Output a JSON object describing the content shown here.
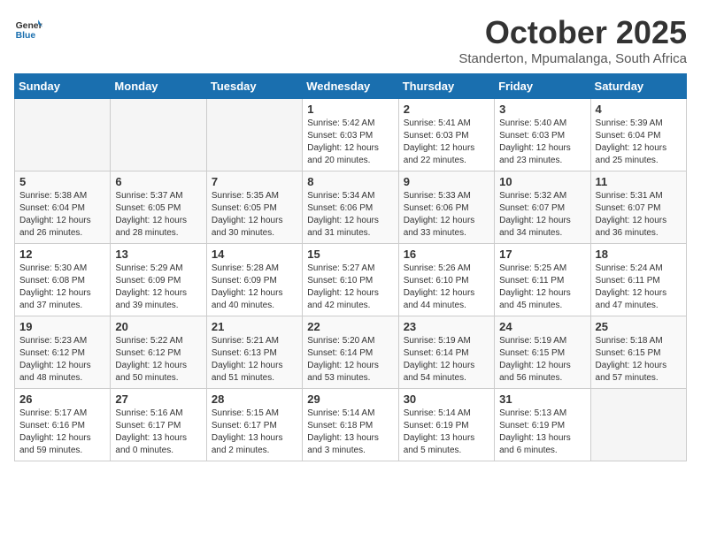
{
  "header": {
    "logo_general": "General",
    "logo_blue": "Blue",
    "month": "October 2025",
    "location": "Standerton, Mpumalanga, South Africa"
  },
  "weekdays": [
    "Sunday",
    "Monday",
    "Tuesday",
    "Wednesday",
    "Thursday",
    "Friday",
    "Saturday"
  ],
  "weeks": [
    [
      {
        "day": "",
        "info": ""
      },
      {
        "day": "",
        "info": ""
      },
      {
        "day": "",
        "info": ""
      },
      {
        "day": "1",
        "info": "Sunrise: 5:42 AM\nSunset: 6:03 PM\nDaylight: 12 hours\nand 20 minutes."
      },
      {
        "day": "2",
        "info": "Sunrise: 5:41 AM\nSunset: 6:03 PM\nDaylight: 12 hours\nand 22 minutes."
      },
      {
        "day": "3",
        "info": "Sunrise: 5:40 AM\nSunset: 6:03 PM\nDaylight: 12 hours\nand 23 minutes."
      },
      {
        "day": "4",
        "info": "Sunrise: 5:39 AM\nSunset: 6:04 PM\nDaylight: 12 hours\nand 25 minutes."
      }
    ],
    [
      {
        "day": "5",
        "info": "Sunrise: 5:38 AM\nSunset: 6:04 PM\nDaylight: 12 hours\nand 26 minutes."
      },
      {
        "day": "6",
        "info": "Sunrise: 5:37 AM\nSunset: 6:05 PM\nDaylight: 12 hours\nand 28 minutes."
      },
      {
        "day": "7",
        "info": "Sunrise: 5:35 AM\nSunset: 6:05 PM\nDaylight: 12 hours\nand 30 minutes."
      },
      {
        "day": "8",
        "info": "Sunrise: 5:34 AM\nSunset: 6:06 PM\nDaylight: 12 hours\nand 31 minutes."
      },
      {
        "day": "9",
        "info": "Sunrise: 5:33 AM\nSunset: 6:06 PM\nDaylight: 12 hours\nand 33 minutes."
      },
      {
        "day": "10",
        "info": "Sunrise: 5:32 AM\nSunset: 6:07 PM\nDaylight: 12 hours\nand 34 minutes."
      },
      {
        "day": "11",
        "info": "Sunrise: 5:31 AM\nSunset: 6:07 PM\nDaylight: 12 hours\nand 36 minutes."
      }
    ],
    [
      {
        "day": "12",
        "info": "Sunrise: 5:30 AM\nSunset: 6:08 PM\nDaylight: 12 hours\nand 37 minutes."
      },
      {
        "day": "13",
        "info": "Sunrise: 5:29 AM\nSunset: 6:09 PM\nDaylight: 12 hours\nand 39 minutes."
      },
      {
        "day": "14",
        "info": "Sunrise: 5:28 AM\nSunset: 6:09 PM\nDaylight: 12 hours\nand 40 minutes."
      },
      {
        "day": "15",
        "info": "Sunrise: 5:27 AM\nSunset: 6:10 PM\nDaylight: 12 hours\nand 42 minutes."
      },
      {
        "day": "16",
        "info": "Sunrise: 5:26 AM\nSunset: 6:10 PM\nDaylight: 12 hours\nand 44 minutes."
      },
      {
        "day": "17",
        "info": "Sunrise: 5:25 AM\nSunset: 6:11 PM\nDaylight: 12 hours\nand 45 minutes."
      },
      {
        "day": "18",
        "info": "Sunrise: 5:24 AM\nSunset: 6:11 PM\nDaylight: 12 hours\nand 47 minutes."
      }
    ],
    [
      {
        "day": "19",
        "info": "Sunrise: 5:23 AM\nSunset: 6:12 PM\nDaylight: 12 hours\nand 48 minutes."
      },
      {
        "day": "20",
        "info": "Sunrise: 5:22 AM\nSunset: 6:12 PM\nDaylight: 12 hours\nand 50 minutes."
      },
      {
        "day": "21",
        "info": "Sunrise: 5:21 AM\nSunset: 6:13 PM\nDaylight: 12 hours\nand 51 minutes."
      },
      {
        "day": "22",
        "info": "Sunrise: 5:20 AM\nSunset: 6:14 PM\nDaylight: 12 hours\nand 53 minutes."
      },
      {
        "day": "23",
        "info": "Sunrise: 5:19 AM\nSunset: 6:14 PM\nDaylight: 12 hours\nand 54 minutes."
      },
      {
        "day": "24",
        "info": "Sunrise: 5:19 AM\nSunset: 6:15 PM\nDaylight: 12 hours\nand 56 minutes."
      },
      {
        "day": "25",
        "info": "Sunrise: 5:18 AM\nSunset: 6:15 PM\nDaylight: 12 hours\nand 57 minutes."
      }
    ],
    [
      {
        "day": "26",
        "info": "Sunrise: 5:17 AM\nSunset: 6:16 PM\nDaylight: 12 hours\nand 59 minutes."
      },
      {
        "day": "27",
        "info": "Sunrise: 5:16 AM\nSunset: 6:17 PM\nDaylight: 13 hours\nand 0 minutes."
      },
      {
        "day": "28",
        "info": "Sunrise: 5:15 AM\nSunset: 6:17 PM\nDaylight: 13 hours\nand 2 minutes."
      },
      {
        "day": "29",
        "info": "Sunrise: 5:14 AM\nSunset: 6:18 PM\nDaylight: 13 hours\nand 3 minutes."
      },
      {
        "day": "30",
        "info": "Sunrise: 5:14 AM\nSunset: 6:19 PM\nDaylight: 13 hours\nand 5 minutes."
      },
      {
        "day": "31",
        "info": "Sunrise: 5:13 AM\nSunset: 6:19 PM\nDaylight: 13 hours\nand 6 minutes."
      },
      {
        "day": "",
        "info": ""
      }
    ]
  ]
}
